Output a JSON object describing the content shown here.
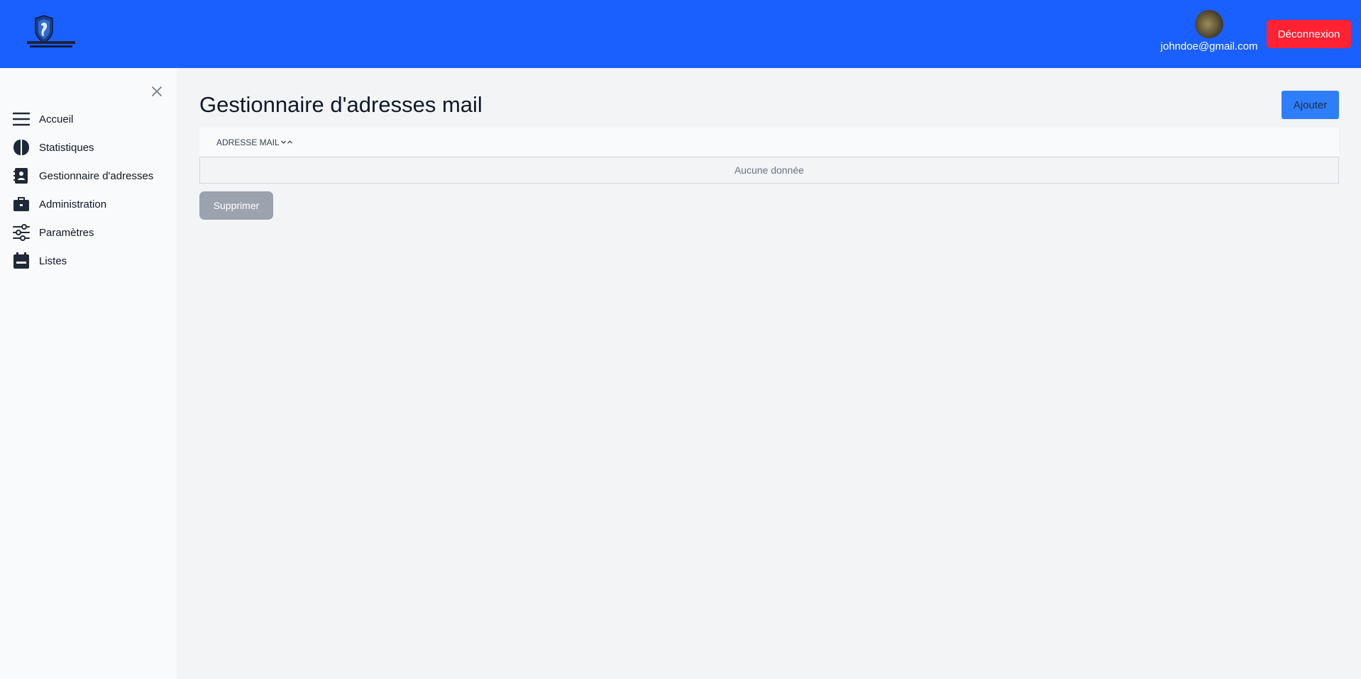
{
  "header": {
    "logo_icon": "shield-logo",
    "user_email": "johndoe@gmail.com",
    "logout_label": "Déconnexion",
    "colors": {
      "topbar": "#1a5fff",
      "logout": "#ff2233"
    }
  },
  "sidebar": {
    "close_icon": "close-icon",
    "items": [
      {
        "label": "Accueil",
        "icon": "menu-icon"
      },
      {
        "label": "Statistiques",
        "icon": "brain-icon"
      },
      {
        "label": "Gestionnaire d'adresses",
        "icon": "address-book-icon"
      },
      {
        "label": "Administration",
        "icon": "briefcase-icon"
      },
      {
        "label": "Paramètres",
        "icon": "sliders-icon"
      },
      {
        "label": "Listes",
        "icon": "calendar-icon"
      }
    ]
  },
  "main": {
    "title": "Gestionnaire d'adresses mail",
    "add_label": "Ajouter",
    "table": {
      "columns": [
        "ADRESSE MAIL"
      ],
      "rows": [],
      "empty_text": "Aucune donnée"
    },
    "delete_label": "Supprimer",
    "colors": {
      "add_button": "#2f7ef9",
      "delete_button": "#9ca3af"
    }
  }
}
